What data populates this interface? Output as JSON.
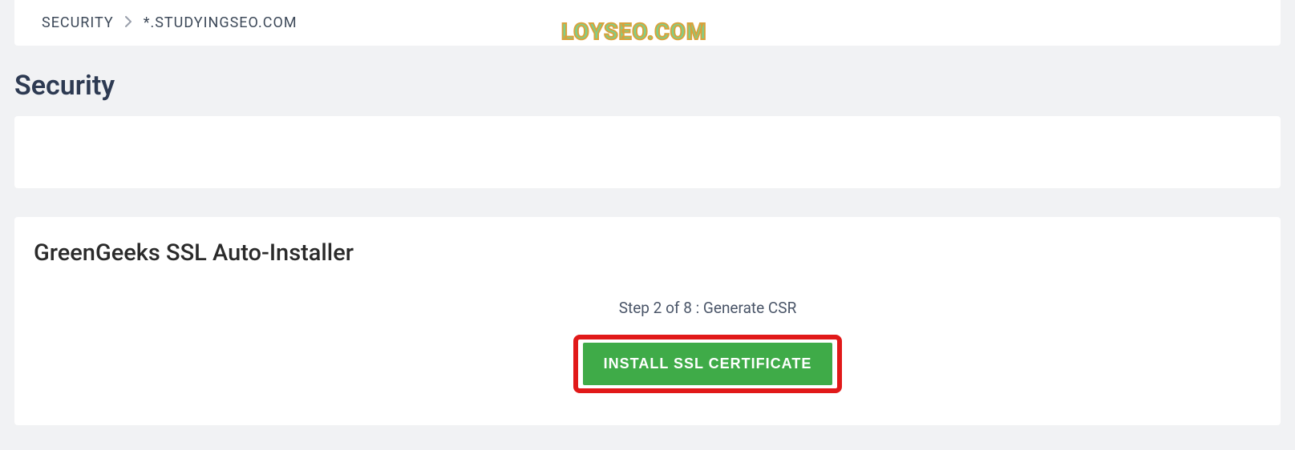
{
  "breadcrumb": {
    "root": "SECURITY",
    "current": "*.STUDYINGSEO.COM"
  },
  "watermark": "LOYSEO.COM",
  "page_title": "Security",
  "installer": {
    "title": "GreenGeeks SSL Auto-Installer",
    "step_text": "Step 2 of 8 : Generate CSR",
    "button_label": "INSTALL SSL CERTIFICATE"
  }
}
